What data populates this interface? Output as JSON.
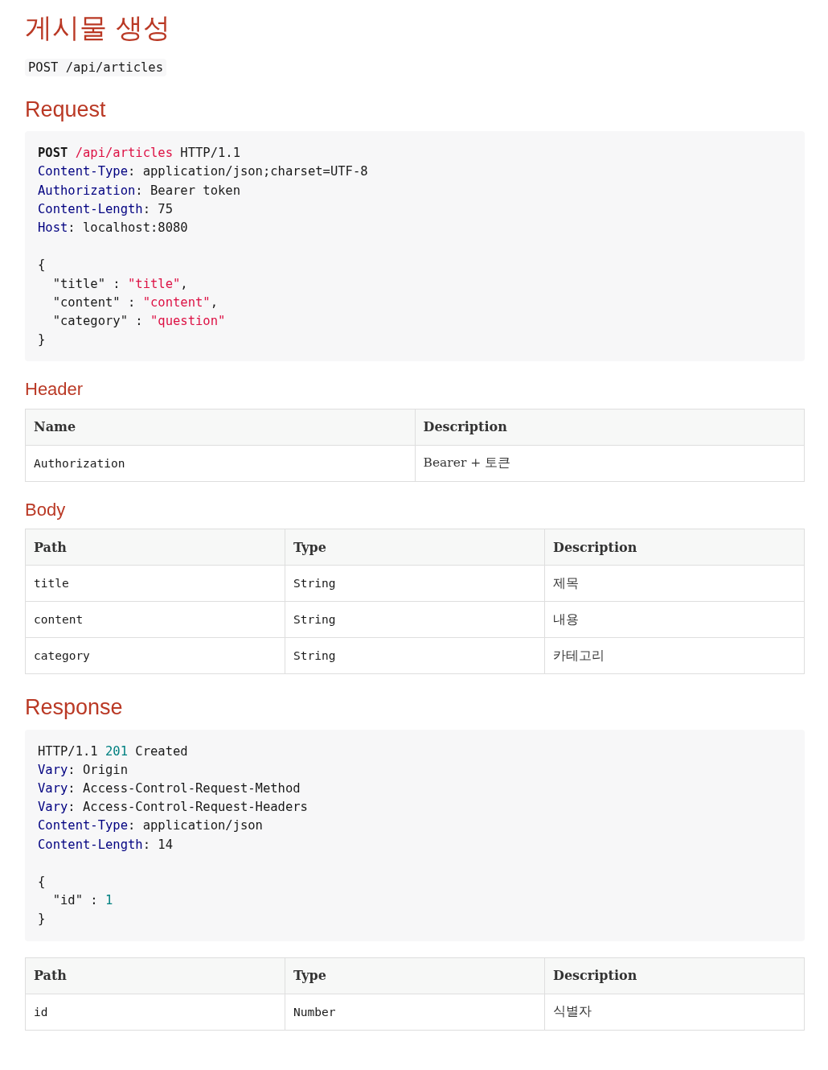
{
  "title": "게시물 생성",
  "endpoint": "POST /api/articles",
  "sections": [
    {
      "kind": "heading",
      "text": "Request"
    },
    {
      "kind": "code",
      "lines": [
        {
          "kind": "text",
          "tokens": [
            {
              "text": "POST ",
              "kind": "keyword"
            },
            {
              "text": "/api/articles",
              "kind": "string"
            },
            {
              "text": " HTTP/1.1",
              "kind": "plain"
            }
          ]
        },
        {
          "kind": "text",
          "tokens": [
            {
              "text": "Content-Type",
              "kind": "attr"
            },
            {
              "text": ": application/json;charset=UTF-8",
              "kind": "plain"
            }
          ]
        },
        {
          "kind": "text",
          "tokens": [
            {
              "text": "Authorization",
              "kind": "attr"
            },
            {
              "text": ": Bearer token",
              "kind": "plain"
            }
          ]
        },
        {
          "kind": "text",
          "tokens": [
            {
              "text": "Content-Length",
              "kind": "attr"
            },
            {
              "text": ": 75",
              "kind": "plain"
            }
          ]
        },
        {
          "kind": "text",
          "tokens": [
            {
              "text": "Host",
              "kind": "attr"
            },
            {
              "text": ": localhost:8080",
              "kind": "plain"
            }
          ]
        },
        {
          "kind": "blank"
        },
        {
          "kind": "text",
          "tokens": [
            {
              "text": "{",
              "kind": "plain"
            }
          ]
        },
        {
          "kind": "text",
          "tokens": [
            {
              "text": "  \"title\" : ",
              "kind": "plain"
            },
            {
              "text": "\"title\"",
              "kind": "string"
            },
            {
              "text": ",",
              "kind": "plain"
            }
          ]
        },
        {
          "kind": "text",
          "tokens": [
            {
              "text": "  \"content\" : ",
              "kind": "plain"
            },
            {
              "text": "\"content\"",
              "kind": "string"
            },
            {
              "text": ",",
              "kind": "plain"
            }
          ]
        },
        {
          "kind": "text",
          "tokens": [
            {
              "text": "  \"category\" : ",
              "kind": "plain"
            },
            {
              "text": "\"question\"",
              "kind": "string"
            }
          ]
        },
        {
          "kind": "text",
          "tokens": [
            {
              "text": "}",
              "kind": "plain"
            }
          ]
        }
      ]
    },
    {
      "kind": "subheading",
      "text": "Header"
    },
    {
      "kind": "table",
      "columns": [
        "Name",
        "Description"
      ],
      "rows": [
        [
          {
            "text": "Authorization",
            "kind": "code"
          },
          {
            "text": "Bearer + 토큰",
            "kind": "text"
          }
        ]
      ]
    },
    {
      "kind": "subheading",
      "text": "Body"
    },
    {
      "kind": "table",
      "columns": [
        "Path",
        "Type",
        "Description"
      ],
      "rows": [
        [
          {
            "text": "title",
            "kind": "code"
          },
          {
            "text": "String",
            "kind": "code"
          },
          {
            "text": "제목",
            "kind": "text"
          }
        ],
        [
          {
            "text": "content",
            "kind": "code"
          },
          {
            "text": "String",
            "kind": "code"
          },
          {
            "text": "내용",
            "kind": "text"
          }
        ],
        [
          {
            "text": "category",
            "kind": "code"
          },
          {
            "text": "String",
            "kind": "code"
          },
          {
            "text": "카테고리",
            "kind": "text"
          }
        ]
      ]
    },
    {
      "kind": "heading",
      "text": "Response"
    },
    {
      "kind": "code",
      "lines": [
        {
          "kind": "text",
          "tokens": [
            {
              "text": "HTTP/1.1 ",
              "kind": "plain"
            },
            {
              "text": "201",
              "kind": "number"
            },
            {
              "text": " Created",
              "kind": "plain"
            }
          ]
        },
        {
          "kind": "text",
          "tokens": [
            {
              "text": "Vary",
              "kind": "attr"
            },
            {
              "text": ": Origin",
              "kind": "plain"
            }
          ]
        },
        {
          "kind": "text",
          "tokens": [
            {
              "text": "Vary",
              "kind": "attr"
            },
            {
              "text": ": Access-Control-Request-Method",
              "kind": "plain"
            }
          ]
        },
        {
          "kind": "text",
          "tokens": [
            {
              "text": "Vary",
              "kind": "attr"
            },
            {
              "text": ": Access-Control-Request-Headers",
              "kind": "plain"
            }
          ]
        },
        {
          "kind": "text",
          "tokens": [
            {
              "text": "Content-Type",
              "kind": "attr"
            },
            {
              "text": ": application/json",
              "kind": "plain"
            }
          ]
        },
        {
          "kind": "text",
          "tokens": [
            {
              "text": "Content-Length",
              "kind": "attr"
            },
            {
              "text": ": 14",
              "kind": "plain"
            }
          ]
        },
        {
          "kind": "blank"
        },
        {
          "kind": "text",
          "tokens": [
            {
              "text": "{",
              "kind": "plain"
            }
          ]
        },
        {
          "kind": "text",
          "tokens": [
            {
              "text": "  \"id\" : ",
              "kind": "plain"
            },
            {
              "text": "1",
              "kind": "number"
            }
          ]
        },
        {
          "kind": "text",
          "tokens": [
            {
              "text": "}",
              "kind": "plain"
            }
          ]
        }
      ]
    },
    {
      "kind": "table",
      "columns": [
        "Path",
        "Type",
        "Description"
      ],
      "rows": [
        [
          {
            "text": "id",
            "kind": "code"
          },
          {
            "text": "Number",
            "kind": "code"
          },
          {
            "text": "식별자",
            "kind": "text"
          }
        ]
      ]
    }
  ]
}
